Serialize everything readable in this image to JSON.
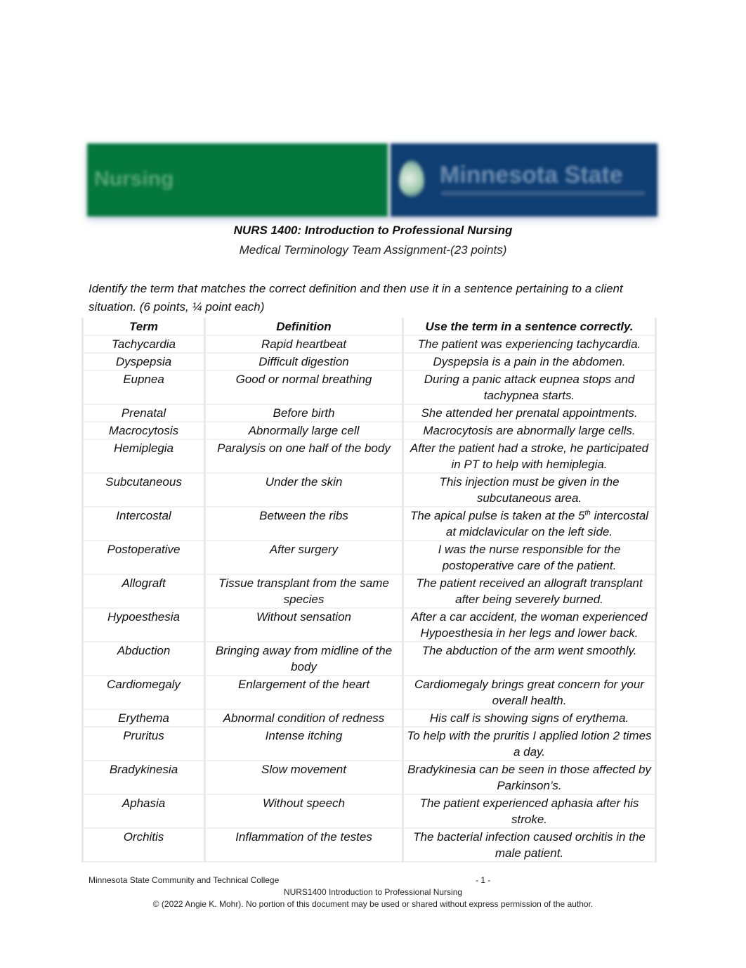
{
  "banner": {
    "left_label": "Nursing",
    "right_label": "Minnesota State",
    "left_color": "#03773d",
    "right_color": "#0f3e72"
  },
  "header": {
    "course_title": "NURS 1400: Introduction to Professional Nursing",
    "assignment_title": "Medical Terminology Team Assignment-(23 points)"
  },
  "instructions": "Identify the term that matches the correct definition and then use it in a sentence pertaining to a client situation. (6 points, ¼ point each)",
  "table": {
    "headers": [
      "Term",
      "Definition",
      "Use the term in a sentence correctly."
    ],
    "rows": [
      {
        "term": "Tachycardia",
        "definition": "Rapid heartbeat",
        "sentence": "The patient was experiencing tachycardia."
      },
      {
        "term": "Dyspepsia",
        "definition": "Difficult digestion",
        "sentence": "Dyspepsia is a pain in the abdomen."
      },
      {
        "term": "Eupnea",
        "definition": "Good or normal breathing",
        "sentence": "During a panic attack eupnea stops and tachypnea starts."
      },
      {
        "term": "Prenatal",
        "definition": "Before birth",
        "sentence": "She attended her prenatal appointments."
      },
      {
        "term": "Macrocytosis",
        "definition": "Abnormally large cell",
        "sentence": "Macrocytosis are abnormally large cells."
      },
      {
        "term": "Hemiplegia",
        "definition": "Paralysis on one half of the body",
        "sentence": "After the patient had a stroke, he participated in PT to help with hemiplegia."
      },
      {
        "term": "Subcutaneous",
        "definition": "Under the skin",
        "sentence": "This injection must be given in the subcutaneous area."
      },
      {
        "term": "Intercostal",
        "definition": "Between the ribs",
        "sentence_pre": "The apical pulse is taken at the 5",
        "sentence_sup": "th",
        "sentence_post": " intercostal at midclavicular on the left side."
      },
      {
        "term": "Postoperative",
        "definition": "After surgery",
        "sentence": "I was the nurse responsible for the postoperative care of the patient."
      },
      {
        "term": "Allograft",
        "definition": "Tissue transplant from the same species",
        "sentence": "The patient received an allograft transplant after being severely burned."
      },
      {
        "term": "Hypoesthesia",
        "definition": "Without sensation",
        "sentence": "After a car accident, the woman experienced Hypoesthesia in her legs and lower back."
      },
      {
        "term": "Abduction",
        "definition": "Bringing away from midline of the body",
        "sentence": "The abduction of the arm went smoothly."
      },
      {
        "term": "Cardiomegaly",
        "definition": "Enlargement of the heart",
        "sentence": "Cardiomegaly brings great concern for your overall health."
      },
      {
        "term": "Erythema",
        "definition": "Abnormal condition of redness",
        "sentence": "His calf is showing signs of erythema."
      },
      {
        "term": "Pruritus",
        "definition": "Intense itching",
        "sentence": "To help with the pruritis I applied lotion 2 times a day."
      },
      {
        "term": "Bradykinesia",
        "definition": "Slow movement",
        "sentence": "Bradykinesia can be seen in those affected by Parkinson’s."
      },
      {
        "term": "Aphasia",
        "definition": "Without speech",
        "sentence": "The patient experienced aphasia after his stroke."
      },
      {
        "term": "Orchitis",
        "definition": "Inflammation of the testes",
        "sentence": "The bacterial infection caused orchitis in the male patient."
      }
    ]
  },
  "footer": {
    "institution": "Minnesota State Community and Technical College",
    "page_number": "- 1 -",
    "course": "NURS1400 Introduction to Professional Nursing",
    "copyright": "© (2022 Angie K. Mohr).  No portion of this document may be used or shared without express permission of the author."
  }
}
